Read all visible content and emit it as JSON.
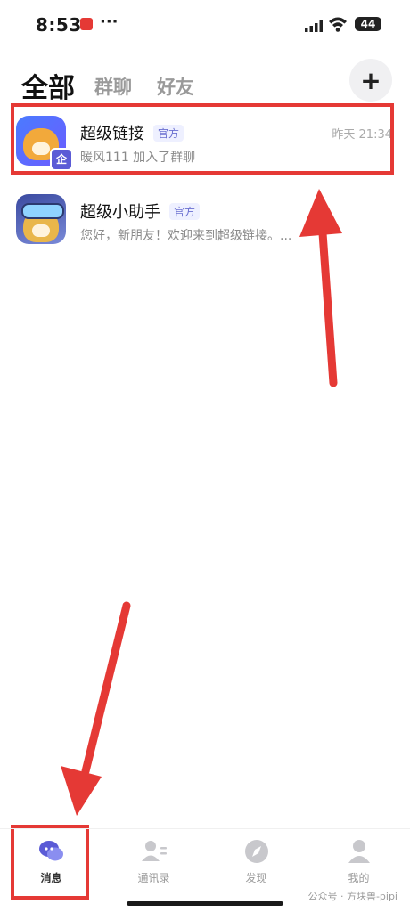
{
  "status_bar": {
    "time": "8:53",
    "more": "···",
    "battery": "44"
  },
  "tabs": [
    {
      "label": "全部",
      "active": true
    },
    {
      "label": "群聊",
      "active": false
    },
    {
      "label": "好友",
      "active": false
    }
  ],
  "add_label": "+",
  "chats": [
    {
      "name": "超级链接",
      "badge": "官方",
      "time": "昨天 21:34",
      "preview": "暖风111 加入了群聊",
      "avatar_badge": "企"
    },
    {
      "name": "超级小助手",
      "badge": "官方",
      "time": "",
      "preview": "您好，新朋友！欢迎来到超级链接。..."
    }
  ],
  "bottom_nav": [
    {
      "label": "消息",
      "icon": "chat-bubble-icon",
      "active": true
    },
    {
      "label": "通讯录",
      "icon": "contacts-icon",
      "active": false
    },
    {
      "label": "发现",
      "icon": "compass-icon",
      "active": false
    },
    {
      "label": "我的",
      "icon": "profile-icon",
      "active": false
    }
  ],
  "watermark": "公众号 · 方块兽-pipi",
  "colors": {
    "highlight": "#e53935",
    "accent": "#5b5bd6",
    "inactive": "#9a9a9a"
  }
}
